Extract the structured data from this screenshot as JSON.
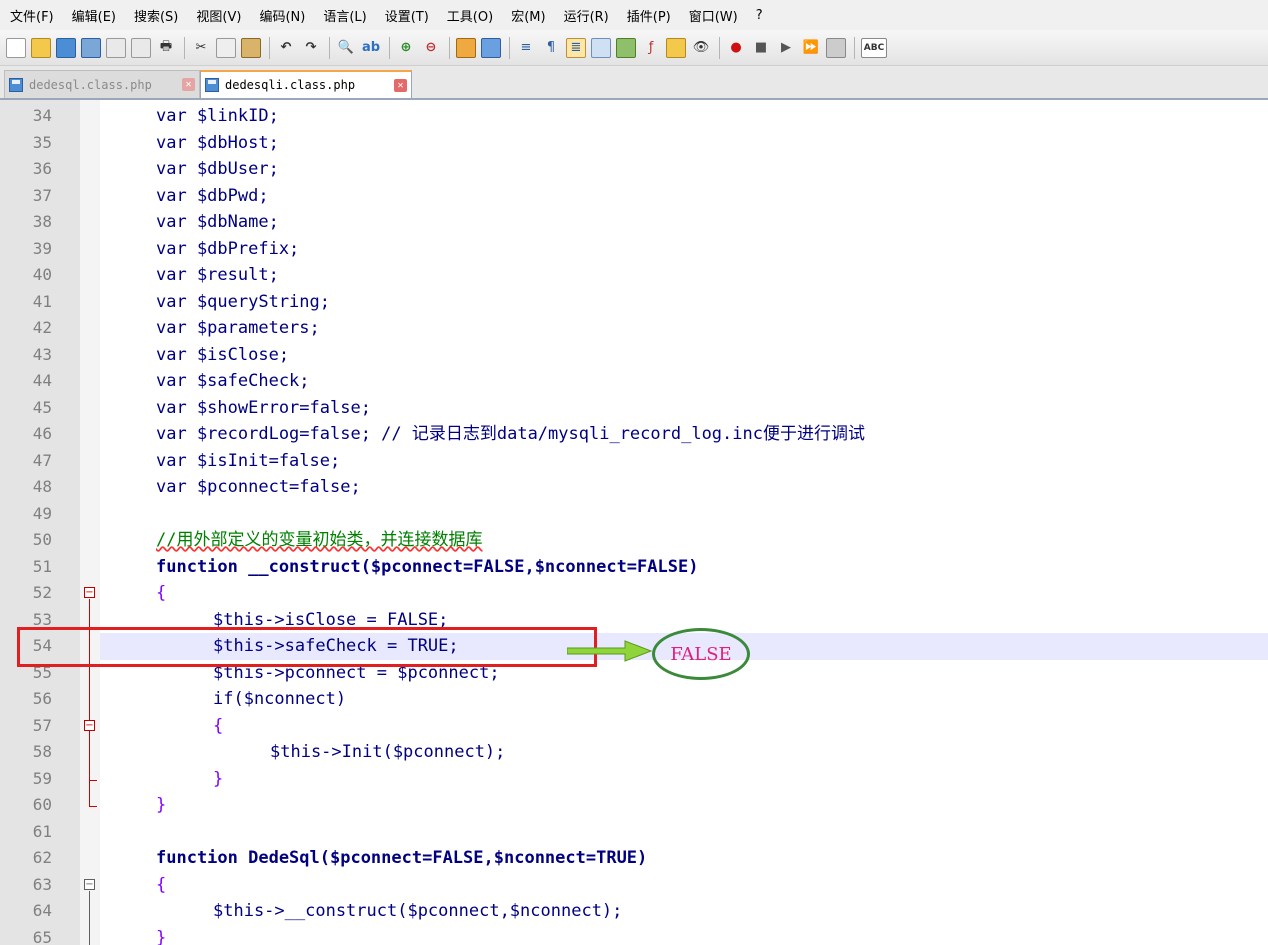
{
  "menu": [
    "文件(F)",
    "编辑(E)",
    "搜索(S)",
    "视图(V)",
    "编码(N)",
    "语言(L)",
    "设置(T)",
    "工具(O)",
    "宏(M)",
    "运行(R)",
    "插件(P)",
    "窗口(W)",
    "?"
  ],
  "toolbar_spell_label": "ABC",
  "tabs": {
    "inactive": {
      "label": "dedesql.class.php"
    },
    "active": {
      "label": "dedesqli.class.php"
    }
  },
  "annotation": {
    "text": "FALSE"
  },
  "code_lines": [
    {
      "n": "34",
      "text": "var $linkID;"
    },
    {
      "n": "35",
      "text": "var $dbHost;"
    },
    {
      "n": "36",
      "text": "var $dbUser;"
    },
    {
      "n": "37",
      "text": "var $dbPwd;"
    },
    {
      "n": "38",
      "text": "var $dbName;"
    },
    {
      "n": "39",
      "text": "var $dbPrefix;"
    },
    {
      "n": "40",
      "text": "var $result;"
    },
    {
      "n": "41",
      "text": "var $queryString;"
    },
    {
      "n": "42",
      "text": "var $parameters;"
    },
    {
      "n": "43",
      "text": "var $isClose;"
    },
    {
      "n": "44",
      "text": "var $safeCheck;"
    },
    {
      "n": "45",
      "text": "var $showError=false;"
    },
    {
      "n": "46",
      "text": "var $recordLog=false; // 记录日志到data/mysqli_record_log.inc便于进行调试"
    },
    {
      "n": "47",
      "text": "var $isInit=false;"
    },
    {
      "n": "48",
      "text": "var $pconnect=false;"
    },
    {
      "n": "49",
      "text": ""
    },
    {
      "n": "50",
      "text": "//用外部定义的变量初始类，并连接数据库"
    },
    {
      "n": "51",
      "text": "function __construct($pconnect=FALSE,$nconnect=FALSE)"
    },
    {
      "n": "52",
      "text": "{"
    },
    {
      "n": "53",
      "text": "$this->isClose = FALSE;"
    },
    {
      "n": "54",
      "text": "$this->safeCheck = TRUE;"
    },
    {
      "n": "55",
      "text": "$this->pconnect = $pconnect;"
    },
    {
      "n": "56",
      "text": "if($nconnect)"
    },
    {
      "n": "57",
      "text": "{"
    },
    {
      "n": "58",
      "text": "$this->Init($pconnect);"
    },
    {
      "n": "59",
      "text": "}"
    },
    {
      "n": "60",
      "text": "}"
    },
    {
      "n": "61",
      "text": ""
    },
    {
      "n": "62",
      "text": "function DedeSql($pconnect=FALSE,$nconnect=TRUE)"
    },
    {
      "n": "63",
      "text": "{"
    },
    {
      "n": "64",
      "text": "$this->__construct($pconnect,$nconnect);"
    },
    {
      "n": "65",
      "text": "}"
    }
  ]
}
